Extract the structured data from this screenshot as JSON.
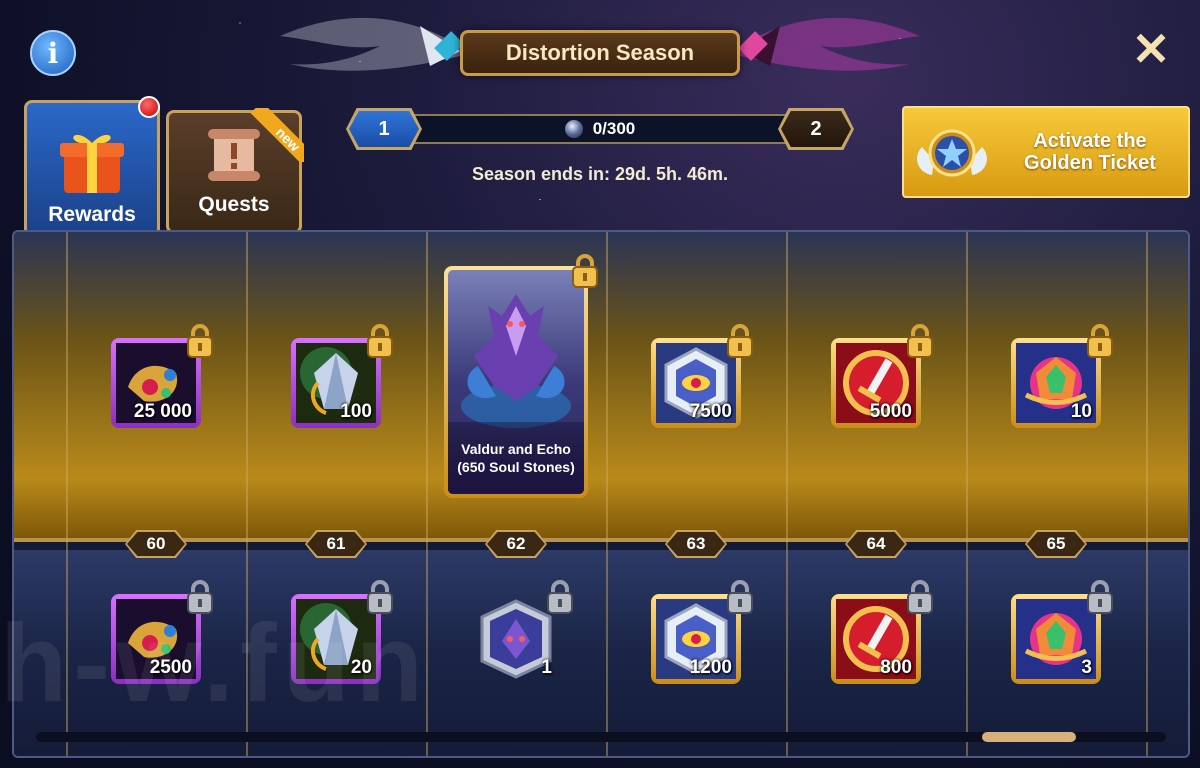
{
  "header": {
    "title": "Distortion Season",
    "info_icon": "info-icon",
    "close_icon": "close-icon"
  },
  "tabs": [
    {
      "label": "Rewards",
      "active": true,
      "notification": true
    },
    {
      "label": "Quests",
      "active": false,
      "ribbon": "new"
    }
  ],
  "progress": {
    "current_level": "1",
    "next_level": "2",
    "points": "0/300",
    "fill_fraction": 0
  },
  "season_ends": "Season ends in: 29d. 5h. 46m.",
  "golden_ticket": {
    "label": "Activate the Golden Ticket"
  },
  "levels": [
    "60",
    "61",
    "62",
    "63",
    "64",
    "65"
  ],
  "top_rewards": [
    {
      "qty": "25 000",
      "icon": "gold-amulet-icon",
      "frame": "purple"
    },
    {
      "qty": "100",
      "icon": "soul-stone-crystal-icon",
      "frame": "purple"
    },
    {
      "hero_name": "Valdur and Echo (650 Soul Stones)",
      "icon": "hero-portrait-icon",
      "frame": "gold"
    },
    {
      "qty": "7500",
      "icon": "eye-hexagon-icon",
      "frame": "gold"
    },
    {
      "qty": "5000",
      "icon": "sword-coin-icon",
      "frame": "gold"
    },
    {
      "qty": "10",
      "icon": "gem-orb-icon",
      "frame": "gold"
    }
  ],
  "bottom_rewards": [
    {
      "qty": "2500",
      "icon": "gold-amulet-icon",
      "frame": "purple"
    },
    {
      "qty": "20",
      "icon": "soul-stone-crystal-icon",
      "frame": "purple"
    },
    {
      "qty": "1",
      "icon": "hero-avatar-icon",
      "frame": "silver"
    },
    {
      "qty": "1200",
      "icon": "eye-hexagon-icon",
      "frame": "gold"
    },
    {
      "qty": "800",
      "icon": "sword-coin-icon",
      "frame": "gold"
    },
    {
      "qty": "3",
      "icon": "gem-orb-icon",
      "frame": "gold"
    }
  ],
  "watermark": "h-w.fun",
  "colors": {
    "gold_accent": "#c9a25b",
    "blue_tab": "#2a68c9",
    "golden_button": "#f7c93a"
  }
}
